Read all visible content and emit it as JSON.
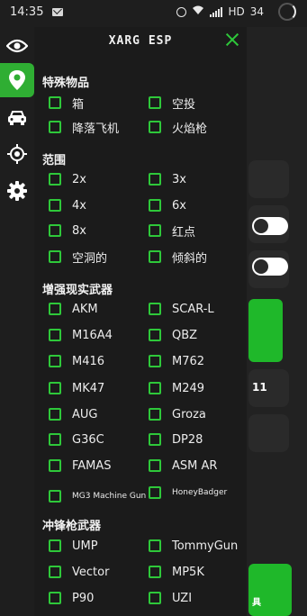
{
  "status": {
    "time": "14:35",
    "battery": "34",
    "network": "HD"
  },
  "header": {
    "title": "XARG ESP"
  },
  "colors": {
    "accent": "#2ec83a",
    "active_sidebar": "#2fae33",
    "panel_bg": "#1b1b1b"
  },
  "sidebar": {
    "items": [
      {
        "icon": "eye-icon"
      },
      {
        "icon": "location-pin-icon",
        "active": true
      },
      {
        "icon": "car-icon"
      },
      {
        "icon": "crosshair-icon"
      },
      {
        "icon": "gear-icon"
      }
    ]
  },
  "sections": {
    "special_items": {
      "title": "特殊物品",
      "items": [
        "箱",
        "空投",
        "降落飞机",
        "火焰枪"
      ]
    },
    "scopes": {
      "title": "范围",
      "items": [
        "2x",
        "3x",
        "4x",
        "6x",
        "8x",
        "红点",
        "空洞的",
        "倾斜的"
      ]
    },
    "ar_weapons": {
      "title": "增强现实武器",
      "items": [
        "AKM",
        "SCAR-L",
        "M16A4",
        "QBZ",
        "M416",
        "M762",
        "MK47",
        "M249",
        "AUG",
        "Groza",
        "G36C",
        "DP28",
        "FAMAS",
        "ASM AR",
        "MG3 Machine Gun",
        "HoneyBadger"
      ]
    },
    "smg_weapons": {
      "title": "冲锋枪武器",
      "items": [
        "UMP",
        "TommyGun",
        "Vector",
        "MP5K",
        "P90",
        "UZI"
      ]
    }
  },
  "background": {
    "partial_text_1": "11",
    "partial_text_2": "具"
  }
}
